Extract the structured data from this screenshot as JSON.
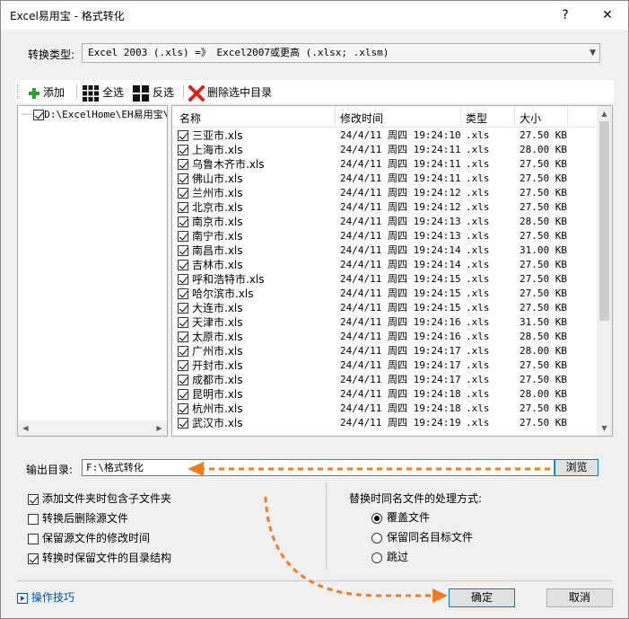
{
  "window": {
    "title": "Excel易用宝 - 格式转化",
    "help": "?",
    "close": "✕"
  },
  "convert": {
    "label": "转换类型:",
    "value": "Excel 2003 (.xls) =》 Excel2007或更高 (.xlsx; .xlsm)"
  },
  "toolbar": {
    "add": "添加",
    "select_all": "全选",
    "invert": "反选",
    "delete": "删除选中目录"
  },
  "tree": {
    "root": "D:\\ExcelHome\\EH易用宝\\"
  },
  "columns": {
    "name": "名称",
    "modified": "修改时间",
    "type": "类型",
    "size": "大小"
  },
  "files": [
    {
      "name": "三亚市.xls",
      "time": "24/4/11 周四 19:24:10",
      "type": ".xls",
      "size": "27.50 KB"
    },
    {
      "name": "上海市.xls",
      "time": "24/4/11 周四 19:24:11",
      "type": ".xls",
      "size": "28.00 KB"
    },
    {
      "name": "乌鲁木齐市.xls",
      "time": "24/4/11 周四 19:24:11",
      "type": ".xls",
      "size": "27.50 KB"
    },
    {
      "name": "佛山市.xls",
      "time": "24/4/11 周四 19:24:11",
      "type": ".xls",
      "size": "27.50 KB"
    },
    {
      "name": "兰州市.xls",
      "time": "24/4/11 周四 19:24:12",
      "type": ".xls",
      "size": "27.50 KB"
    },
    {
      "name": "北京市.xls",
      "time": "24/4/11 周四 19:24:12",
      "type": ".xls",
      "size": "27.50 KB"
    },
    {
      "name": "南京市.xls",
      "time": "24/4/11 周四 19:24:13",
      "type": ".xls",
      "size": "28.50 KB"
    },
    {
      "name": "南宁市.xls",
      "time": "24/4/11 周四 19:24:13",
      "type": ".xls",
      "size": "27.50 KB"
    },
    {
      "name": "南昌市.xls",
      "time": "24/4/11 周四 19:24:14",
      "type": ".xls",
      "size": "31.00 KB"
    },
    {
      "name": "吉林市.xls",
      "time": "24/4/11 周四 19:24:14",
      "type": ".xls",
      "size": "27.50 KB"
    },
    {
      "name": "呼和浩特市.xls",
      "time": "24/4/11 周四 19:24:15",
      "type": ".xls",
      "size": "27.50 KB"
    },
    {
      "name": "哈尔滨市.xls",
      "time": "24/4/11 周四 19:24:15",
      "type": ".xls",
      "size": "27.50 KB"
    },
    {
      "name": "大连市.xls",
      "time": "24/4/11 周四 19:24:15",
      "type": ".xls",
      "size": "27.50 KB"
    },
    {
      "name": "天津市.xls",
      "time": "24/4/11 周四 19:24:16",
      "type": ".xls",
      "size": "31.50 KB"
    },
    {
      "name": "太原市.xls",
      "time": "24/4/11 周四 19:24:16",
      "type": ".xls",
      "size": "28.50 KB"
    },
    {
      "name": "广州市.xls",
      "time": "24/4/11 周四 19:24:17",
      "type": ".xls",
      "size": "28.00 KB"
    },
    {
      "name": "开封市.xls",
      "time": "24/4/11 周四 19:24:17",
      "type": ".xls",
      "size": "27.50 KB"
    },
    {
      "name": "成都市.xls",
      "time": "24/4/11 周四 19:24:17",
      "type": ".xls",
      "size": "27.50 KB"
    },
    {
      "name": "昆明市.xls",
      "time": "24/4/11 周四 19:24:18",
      "type": ".xls",
      "size": "28.00 KB"
    },
    {
      "name": "杭州市.xls",
      "time": "24/4/11 周四 19:24:18",
      "type": ".xls",
      "size": "27.50 KB"
    },
    {
      "name": "武汉市.xls",
      "time": "24/4/11 周四 19:24:19",
      "type": ".xls",
      "size": "27.50 KB"
    }
  ],
  "output": {
    "label": "输出目录:",
    "value": "F:\\格式转化",
    "browse": "浏览"
  },
  "options": [
    {
      "label": "添加文件夹时包含子文件夹",
      "checked": true
    },
    {
      "label": "转换后删除源文件",
      "checked": false
    },
    {
      "label": "保留源文件的修改时间",
      "checked": false
    },
    {
      "label": "转换时保留文件的目录结构",
      "checked": true
    }
  ],
  "replace": {
    "title": "替换时同名文件的处理方式:",
    "choices": [
      {
        "label": "覆盖文件",
        "selected": true
      },
      {
        "label": "保留同名目标文件",
        "selected": false
      },
      {
        "label": "跳过",
        "selected": false
      }
    ]
  },
  "footer": {
    "tips": "操作技巧",
    "ok": "确定",
    "cancel": "取消"
  },
  "colors": {
    "accent": "#0078d7",
    "arrow": "#f07c1e",
    "add_icon": "#2aa12a",
    "delete_icon": "#d9251c"
  }
}
